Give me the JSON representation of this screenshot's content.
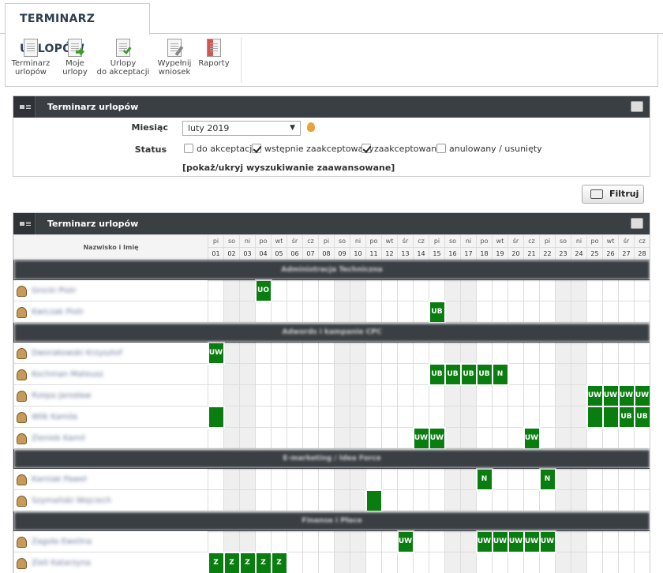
{
  "tab": {
    "title": "TERMINARZ URLOPÓW"
  },
  "toolbar": [
    {
      "line1": "Terminarz",
      "line2": "urlopów",
      "icon": "calendar-list-icon"
    },
    {
      "line1": "Moje",
      "line2": "urlopy",
      "icon": "my-leave-icon"
    },
    {
      "line1": "Urlopy",
      "line2": "do akceptacji",
      "icon": "approve-icon"
    },
    {
      "line1": "Wypełnij",
      "line2": "wniosek",
      "icon": "fill-form-icon"
    },
    {
      "line1": "Raporty",
      "line2": "",
      "icon": "reports-icon"
    }
  ],
  "search": {
    "title": "Terminarz urlopów",
    "month_label": "Miesiąc",
    "month_value": "luty 2019",
    "status_label": "Status",
    "statuses": [
      {
        "label": "do akceptacji",
        "checked": false
      },
      {
        "label": "wstępnie zaakceptowany",
        "checked": true
      },
      {
        "label": "zaakceptowany",
        "checked": true
      },
      {
        "label": "anulowany / usunięty",
        "checked": false
      }
    ],
    "advanced_link": "[pokaż/ukryj wyszukiwanie zaawansowane]"
  },
  "filter_button": "Filtruj",
  "grid": {
    "title": "Terminarz urlopów",
    "name_header": "Nazwisko i Imię",
    "today": 20,
    "colors": {
      "leave": "#0a7d10",
      "header": "#3a3f44",
      "today": "#e07a1a"
    },
    "days": [
      "pi",
      "so",
      "ni",
      "po",
      "wt",
      "śr",
      "cz",
      "pi",
      "so",
      "ni",
      "po",
      "wt",
      "śr",
      "cz",
      "pi",
      "so",
      "ni",
      "po",
      "wt",
      "śr",
      "cz",
      "pi",
      "so",
      "ni",
      "po",
      "wt",
      "śr",
      "cz"
    ],
    "nums": [
      "01",
      "02",
      "03",
      "04",
      "05",
      "06",
      "07",
      "08",
      "09",
      "10",
      "11",
      "12",
      "13",
      "14",
      "15",
      "16",
      "17",
      "18",
      "19",
      "20",
      "21",
      "22",
      "23",
      "24",
      "25",
      "26",
      "27",
      "28"
    ],
    "rows": [
      {
        "group": "Administracja Techniczna"
      },
      {
        "name": "Gnicki Piotr",
        "leaves": {
          "4": "UO"
        }
      },
      {
        "name": "Kwiczak Piotr",
        "leaves": {
          "15": "UB"
        }
      },
      {
        "group": "Adwords i kampanie CPC"
      },
      {
        "name": "Dworakowski Krzysztof",
        "leaves": {
          "1": "UW"
        }
      },
      {
        "name": "Kochman Mateusz",
        "leaves": {
          "15": "UB",
          "16": "UB",
          "17": "UB",
          "18": "UB",
          "19": "N"
        }
      },
      {
        "name": "Rzepa Jarosław",
        "leaves": {
          "25": "UW",
          "26": "UW",
          "27": "UW",
          "28": "UW"
        }
      },
      {
        "name": "Wilk Kamila",
        "leaves": {
          "1": "",
          "25": "",
          "26": "",
          "27": "UB",
          "28": "UB"
        }
      },
      {
        "name": "Zieniek Kamil",
        "leaves": {
          "14": "UW",
          "15": "UW",
          "21": "UW"
        }
      },
      {
        "group": "E-marketing / Idea Force"
      },
      {
        "name": "Karniak Paweł",
        "leaves": {
          "18": "N",
          "22": "N"
        }
      },
      {
        "name": "Szymański Wojciech",
        "leaves": {
          "11": ""
        }
      },
      {
        "group": "Finanse i Płace"
      },
      {
        "name": "Zagoła Ewelina",
        "leaves": {
          "13": "UW",
          "18": "UW",
          "19": "UW",
          "20": "UW",
          "21": "UW",
          "22": "UW"
        }
      },
      {
        "name": "Zieli Katarzyna",
        "leaves": {
          "1": "Z",
          "2": "Z",
          "3": "Z",
          "4": "Z",
          "5": "Z"
        }
      }
    ]
  }
}
